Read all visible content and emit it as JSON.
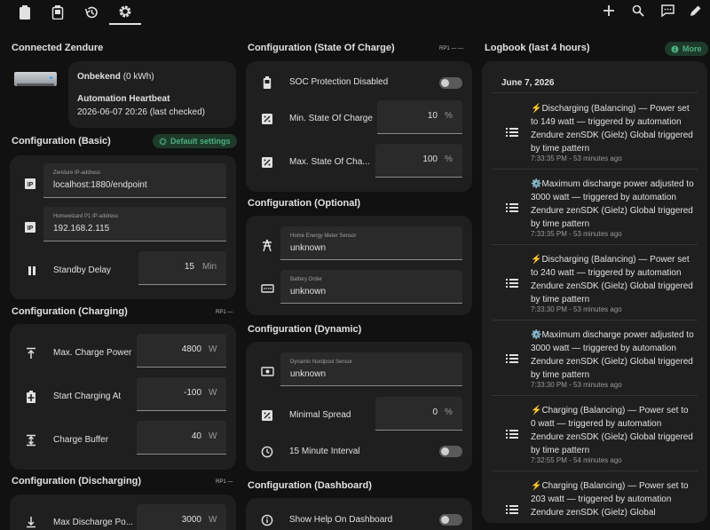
{
  "topbar": {
    "tabs": [
      {
        "name": "battery-icon"
      },
      {
        "name": "battery-status-icon"
      },
      {
        "name": "history-icon"
      },
      {
        "name": "gear-icon",
        "active": true
      }
    ],
    "actions": [
      "plus-icon",
      "search-icon",
      "chat-icon",
      "pencil-icon"
    ]
  },
  "connected": {
    "title": "Connected Zendure",
    "device_name": "Onbekend",
    "device_capacity": "(0 kWh)",
    "heartbeat_title": "Automation Heartbeat",
    "heartbeat_value": "2026-06-07 20:26 (last checked)"
  },
  "basic": {
    "title": "Configuration (Basic)",
    "badge": "Default settings",
    "ip_label": "Zendure IP-address",
    "ip_value": "localhost:1880/endpoint",
    "p1_label": "Homewizard P1 IP-address",
    "p1_value": "192.168.2.115",
    "standby_label": "Standby Delay",
    "standby_value": "15",
    "standby_unit": "Min"
  },
  "charging": {
    "title": "Configuration (Charging)",
    "mark": "RP1 —",
    "rows": [
      {
        "label": "Max. Charge Power",
        "value": "4800",
        "unit": "W"
      },
      {
        "label": "Start Charging At",
        "value": "-100",
        "unit": "W"
      },
      {
        "label": "Charge Buffer",
        "value": "40",
        "unit": "W"
      }
    ]
  },
  "discharging": {
    "title": "Configuration (Discharging)",
    "mark": "RP1 —",
    "row_label": "Max Discharge Po...",
    "row_value": "3000",
    "row_unit": "W"
  },
  "soc": {
    "title": "Configuration (State Of Charge)",
    "mark": "RP1 —  —",
    "protection_label": "SOC Protection Disabled",
    "rows": [
      {
        "label": "Min. State Of Charge",
        "value": "10",
        "unit": "%"
      },
      {
        "label": "Max. State Of Cha...",
        "value": "100",
        "unit": "%"
      }
    ]
  },
  "optional": {
    "title": "Configuration (Optional)",
    "meter_label": "Home Energy Meter Sensor",
    "meter_value": "unknown",
    "order_label": "Battery Order",
    "order_value": "unknown"
  },
  "dynamic": {
    "title": "Configuration (Dynamic)",
    "nordpool_label": "Dynamic Nordpool Sensor",
    "nordpool_value": "unknown",
    "spread_label": "Minimal Spread",
    "spread_value": "0",
    "spread_unit": "%",
    "interval_label": "15 Minute Interval"
  },
  "dashboard": {
    "title": "Configuration (Dashboard)",
    "help_label": "Show Help On Dashboard"
  },
  "logbook": {
    "title": "Logbook (last 4 hours)",
    "more": "More",
    "date": "June 7, 2026",
    "entries": [
      {
        "text": "⚡Discharging (Balancing) — Power set to 149 watt — triggered by automation Zendure zenSDK (Gielz) Global triggered by time pattern",
        "time": "7:33:35 PM - 53 minutes ago"
      },
      {
        "text": "⚙️Maximum discharge power adjusted to 3000 watt — triggered by automation Zendure zenSDK (Gielz) Global triggered by time pattern",
        "time": "7:33:35 PM - 53 minutes ago"
      },
      {
        "text": "⚡Discharging (Balancing) — Power set to 240 watt — triggered by automation Zendure zenSDK (Gielz) Global triggered by time pattern",
        "time": "7:33:30 PM - 53 minutes ago"
      },
      {
        "text": "⚙️Maximum discharge power adjusted to 3000 watt — triggered by automation Zendure zenSDK (Gielz) Global triggered by time pattern",
        "time": "7:33:30 PM - 53 minutes ago"
      },
      {
        "text": "⚡Charging (Balancing) — Power set to 0 watt — triggered by automation Zendure zenSDK (Gielz) Global triggered by time pattern",
        "time": "7:32:55 PM - 54 minutes ago"
      },
      {
        "text": "⚡Charging (Balancing) — Power set to 203 watt — triggered by automation Zendure zenSDK (Gielz) Global",
        "time": ""
      }
    ]
  },
  "colors": {
    "background": "#111111",
    "card": "#1f1f1f",
    "field": "#2a2a2a",
    "accent_green": "#4caf80"
  }
}
